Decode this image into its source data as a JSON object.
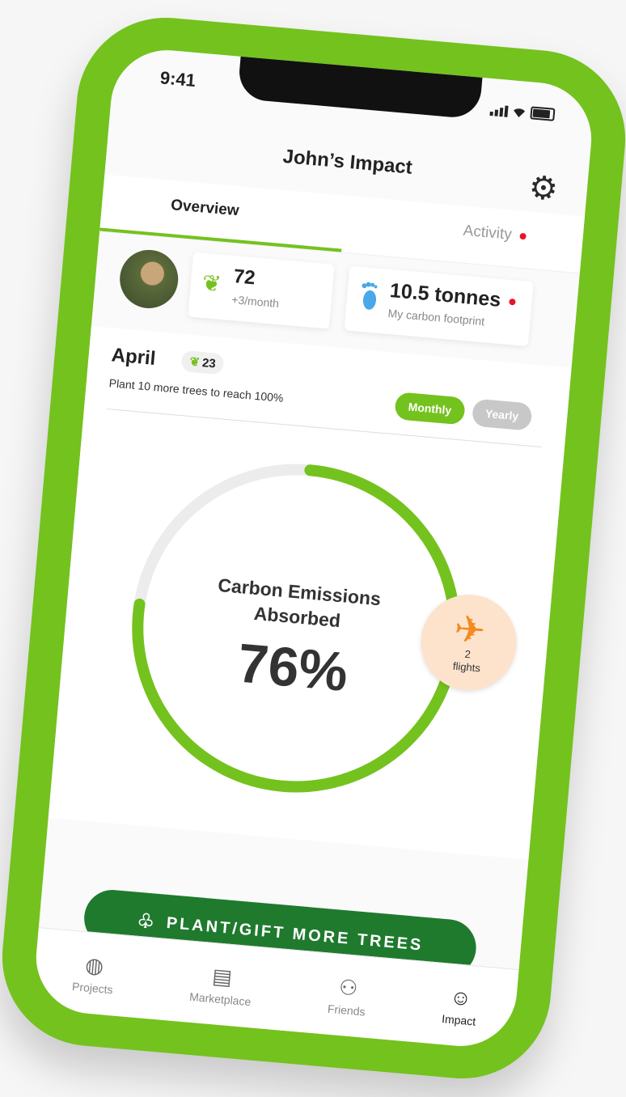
{
  "status_bar": {
    "time": "9:41"
  },
  "header": {
    "title": "John’s Impact",
    "settings_icon": "gear-icon"
  },
  "tabs": [
    {
      "label": "Overview",
      "active": true
    },
    {
      "label": "Activity",
      "active": false,
      "notification": true
    }
  ],
  "stats": {
    "trees": {
      "value": "72",
      "rate": "+3/month",
      "icon": "sprout-icon"
    },
    "footprint": {
      "value": "10.5 tonnes",
      "label": "My carbon footprint",
      "icon": "footprint-icon",
      "notification": true
    }
  },
  "period": {
    "month": "April",
    "trees_count": "23",
    "goal_text": "Plant 10 more trees to reach 100%",
    "toggle": {
      "monthly": "Monthly",
      "yearly": "Yearly",
      "selected": "Monthly"
    }
  },
  "gauge": {
    "title_line1": "Carbon Emissions",
    "title_line2": "Absorbed",
    "value_text": "76%",
    "fraction": 0.76
  },
  "flights_badge": {
    "count": "2",
    "label": "flights",
    "icon": "airplane-icon"
  },
  "cta": {
    "label": "PLANT/GIFT MORE TREES",
    "icon": "tree-icon"
  },
  "bottom_nav": [
    {
      "label": "Projects",
      "icon": "globe-icon",
      "active": false
    },
    {
      "label": "Marketplace",
      "icon": "store-icon",
      "active": false
    },
    {
      "label": "Friends",
      "icon": "friends-icon",
      "active": false
    },
    {
      "label": "Impact",
      "icon": "smiley-icon",
      "active": true
    }
  ],
  "colors": {
    "brand_green": "#74c21e",
    "cta_green": "#1f7a2e",
    "alert_red": "#e8122a",
    "flight_orange": "#f58a1f"
  }
}
